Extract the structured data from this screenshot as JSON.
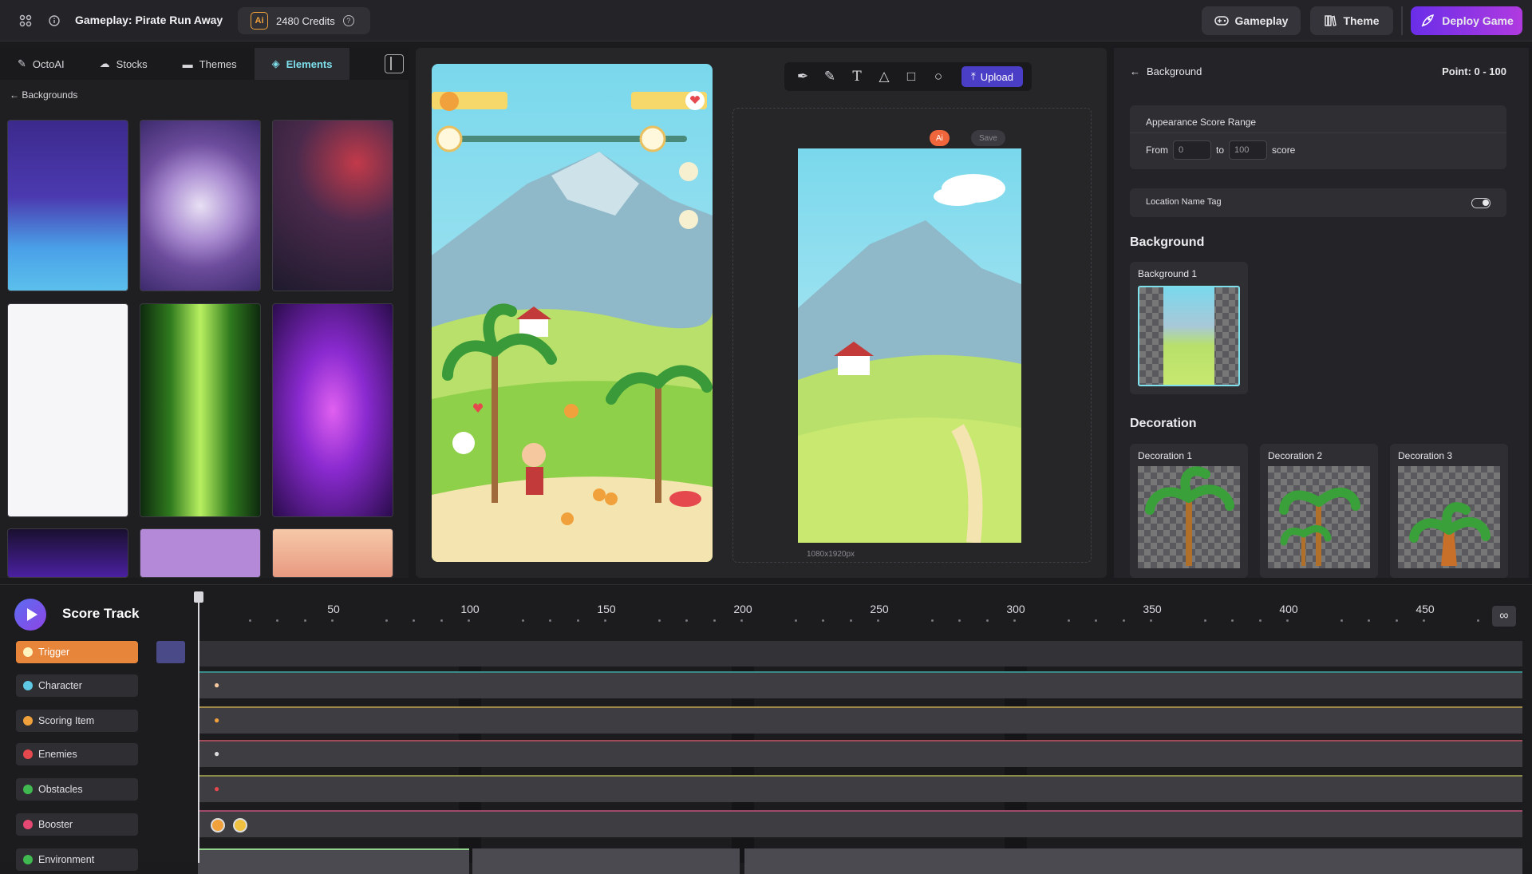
{
  "topbar": {
    "title": "Gameplay: Pirate Run Away",
    "credits_badge": "Ai",
    "credits": "2480 Credits",
    "help": "?",
    "buttons": {
      "gameplay": "Gameplay",
      "theme": "Theme",
      "deploy": "Deploy Game"
    }
  },
  "left_panel": {
    "tabs": [
      {
        "label": "OctoAI",
        "icon": "magic-wand-icon"
      },
      {
        "label": "Stocks",
        "icon": "cloud-icon"
      },
      {
        "label": "Themes",
        "icon": "folder-icon"
      },
      {
        "label": "Elements",
        "icon": "layers-icon",
        "active": true
      }
    ],
    "breadcrumb": "Backgrounds"
  },
  "canvas": {
    "tools": [
      "pen-icon",
      "pencil-icon",
      "text-icon",
      "triangle-icon",
      "square-icon",
      "circle-icon"
    ],
    "upload_label": "Upload",
    "ai_chip": "Ai",
    "save_chip": "Save",
    "dimensions": "1080x1920px"
  },
  "right_panel": {
    "back_label": "Background",
    "point_label": "Point: 0 - 100",
    "score_range": {
      "title": "Appearance Score Range",
      "from_label": "From",
      "from_value": "0",
      "to_label": "to",
      "to_value": "100",
      "unit": "score"
    },
    "location_tag": {
      "label": "Location Name Tag",
      "enabled": true
    },
    "background_section": "Background",
    "backgrounds": [
      {
        "label": "Background 1"
      }
    ],
    "decoration_section": "Decoration",
    "decorations": [
      {
        "label": "Decoration 1"
      },
      {
        "label": "Decoration 2"
      },
      {
        "label": "Decoration 3"
      }
    ]
  },
  "timeline": {
    "title": "Score Track",
    "ticks": [
      "50",
      "100",
      "150",
      "200",
      "250",
      "300",
      "350",
      "400",
      "450"
    ],
    "infinity": "∞",
    "rows": [
      {
        "label": "Trigger",
        "color": "#f5c542"
      },
      {
        "label": "Character",
        "color": "#5ec8e5"
      },
      {
        "label": "Scoring Item",
        "color": "#f0a13c"
      },
      {
        "label": "Enemies",
        "color": "#e5484d"
      },
      {
        "label": "Obstacles",
        "color": "#3fb950"
      },
      {
        "label": "Booster",
        "color": "#e54873"
      },
      {
        "label": "Environment",
        "color": "#3fb950"
      }
    ]
  },
  "colors": {
    "accent": "#7fe0ec",
    "brand_gradient_start": "#6a2ee8",
    "brand_gradient_end": "#b03ae0",
    "trigger": "#e7853a"
  }
}
